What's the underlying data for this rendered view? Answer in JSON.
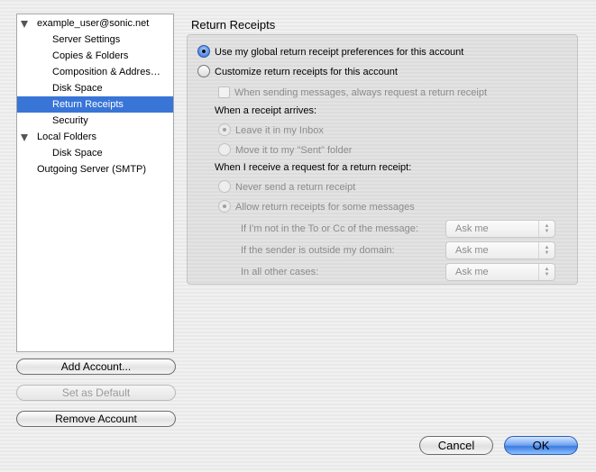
{
  "account_tree": {
    "items": [
      {
        "label": "example_user@sonic.net",
        "level": 0,
        "expanded": true,
        "selected": false
      },
      {
        "label": "Server Settings",
        "level": 1,
        "selected": false
      },
      {
        "label": "Copies & Folders",
        "level": 1,
        "selected": false
      },
      {
        "label": "Composition & Addres…",
        "level": 1,
        "selected": false
      },
      {
        "label": "Disk Space",
        "level": 1,
        "selected": false
      },
      {
        "label": "Return Receipts",
        "level": 1,
        "selected": true
      },
      {
        "label": "Security",
        "level": 1,
        "selected": false
      },
      {
        "label": "Local Folders",
        "level": 0,
        "expanded": true,
        "selected": false
      },
      {
        "label": "Disk Space",
        "level": 1,
        "selected": false
      },
      {
        "label": "Outgoing Server (SMTP)",
        "level": 0,
        "selected": false
      }
    ]
  },
  "buttons": {
    "add_account": "Add Account...",
    "set_default": "Set as Default",
    "remove_account": "Remove Account",
    "cancel": "Cancel",
    "ok": "OK"
  },
  "panel": {
    "title": "Return Receipts",
    "use_global": "Use my global return receipt preferences for this account",
    "customize": "Customize return receipts for this account",
    "always_request": "When sending messages, always request a return receipt",
    "arrives_heading": "When a receipt arrives:",
    "leave_inbox": "Leave it in my Inbox",
    "move_sent": "Move it to my \"Sent\" folder",
    "request_heading": "When I receive a request for a return receipt:",
    "never_send": "Never send a return receipt",
    "allow_some": "Allow return receipts for some messages",
    "not_in_to_cc": "If I'm not in the To or Cc of the message:",
    "outside_domain": "If the sender is outside my domain:",
    "other_cases": "In all other cases:",
    "select_value_1": "Ask me",
    "select_value_2": "Ask me",
    "select_value_3": "Ask me"
  },
  "colors": {
    "selection": "#3875d7",
    "default_button": "#3b7ae0"
  }
}
